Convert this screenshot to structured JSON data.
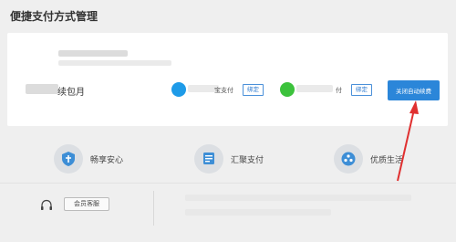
{
  "page": {
    "title": "便捷支付方式管理"
  },
  "subscription": {
    "label": "续包月",
    "payments": [
      {
        "name": "宝支付",
        "bind_label": "绑定",
        "icon_color": "#1e9be8"
      },
      {
        "name": "付",
        "bind_label": "绑定",
        "icon_color": "#3cc23c"
      }
    ],
    "close_button_label": "关闭自动续费"
  },
  "features": [
    {
      "label": "畅享安心",
      "icon": "shield-icon"
    },
    {
      "label": "汇聚支付",
      "icon": "card-icon"
    },
    {
      "label": "优质生活",
      "icon": "life-icon"
    }
  ],
  "footer": {
    "service_button_label": "会员客服",
    "service_icon": "headset-icon"
  },
  "colors": {
    "accent": "#2b86d9",
    "arrow": "#e03030"
  }
}
